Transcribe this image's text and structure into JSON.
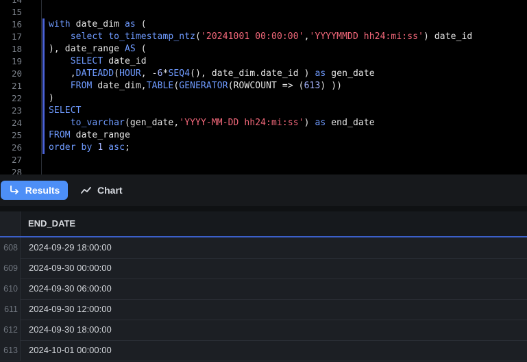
{
  "editor": {
    "lines": [
      {
        "num": "14",
        "tokens": []
      },
      {
        "num": "15",
        "tokens": []
      },
      {
        "num": "16",
        "tokens": [
          {
            "t": "with",
            "c": "kw"
          },
          {
            "t": " date_dim ",
            "c": "plain"
          },
          {
            "t": "as",
            "c": "kw"
          },
          {
            "t": " (",
            "c": "plain"
          }
        ]
      },
      {
        "num": "17",
        "tokens": [
          {
            "t": "    ",
            "c": "plain"
          },
          {
            "t": "select",
            "c": "kw"
          },
          {
            "t": " ",
            "c": "plain"
          },
          {
            "t": "to_timestamp_ntz",
            "c": "kw"
          },
          {
            "t": "(",
            "c": "plain"
          },
          {
            "t": "'20241001 00:00:00'",
            "c": "str"
          },
          {
            "t": ",",
            "c": "plain"
          },
          {
            "t": "'YYYYMMDD hh24:mi:ss'",
            "c": "str"
          },
          {
            "t": ") date_id",
            "c": "plain"
          }
        ]
      },
      {
        "num": "18",
        "tokens": [
          {
            "t": "), date_range ",
            "c": "plain"
          },
          {
            "t": "AS",
            "c": "kw"
          },
          {
            "t": " (",
            "c": "plain"
          }
        ]
      },
      {
        "num": "19",
        "tokens": [
          {
            "t": "    ",
            "c": "plain"
          },
          {
            "t": "SELECT",
            "c": "kw"
          },
          {
            "t": " date_id",
            "c": "plain"
          }
        ]
      },
      {
        "num": "20",
        "tokens": [
          {
            "t": "    ,",
            "c": "plain"
          },
          {
            "t": "DATEADD",
            "c": "kw"
          },
          {
            "t": "(",
            "c": "plain"
          },
          {
            "t": "HOUR",
            "c": "kw"
          },
          {
            "t": ", -",
            "c": "plain"
          },
          {
            "t": "6",
            "c": "num"
          },
          {
            "t": "*",
            "c": "plain"
          },
          {
            "t": "SEQ4",
            "c": "kw"
          },
          {
            "t": "(), date_dim.date_id ) ",
            "c": "plain"
          },
          {
            "t": "as",
            "c": "kw"
          },
          {
            "t": " gen_date",
            "c": "plain"
          }
        ]
      },
      {
        "num": "21",
        "tokens": [
          {
            "t": "    ",
            "c": "plain"
          },
          {
            "t": "FROM",
            "c": "kw"
          },
          {
            "t": " date_dim,",
            "c": "plain"
          },
          {
            "t": "TABLE",
            "c": "kw"
          },
          {
            "t": "(",
            "c": "plain"
          },
          {
            "t": "GENERATOR",
            "c": "kw"
          },
          {
            "t": "(ROWCOUNT => (",
            "c": "plain"
          },
          {
            "t": "613",
            "c": "num"
          },
          {
            "t": ") ))",
            "c": "plain"
          }
        ]
      },
      {
        "num": "22",
        "tokens": [
          {
            "t": ")",
            "c": "plain"
          }
        ]
      },
      {
        "num": "23",
        "tokens": [
          {
            "t": "SELECT",
            "c": "kw"
          }
        ]
      },
      {
        "num": "24",
        "tokens": [
          {
            "t": "    ",
            "c": "plain"
          },
          {
            "t": "to_varchar",
            "c": "kw"
          },
          {
            "t": "(gen_date,",
            "c": "plain"
          },
          {
            "t": "'YYYY-MM-DD hh24:mi:ss'",
            "c": "str"
          },
          {
            "t": ") ",
            "c": "plain"
          },
          {
            "t": "as",
            "c": "kw"
          },
          {
            "t": " end_date",
            "c": "plain"
          }
        ]
      },
      {
        "num": "25",
        "tokens": [
          {
            "t": "FROM",
            "c": "kw"
          },
          {
            "t": " date_range",
            "c": "plain"
          }
        ]
      },
      {
        "num": "26",
        "tokens": [
          {
            "t": "order by",
            "c": "kw"
          },
          {
            "t": " ",
            "c": "plain"
          },
          {
            "t": "1",
            "c": "num"
          },
          {
            "t": " ",
            "c": "plain"
          },
          {
            "t": "asc",
            "c": "kw"
          },
          {
            "t": ";",
            "c": "plain"
          }
        ]
      },
      {
        "num": "27",
        "tokens": []
      },
      {
        "num": "28",
        "tokens": []
      }
    ]
  },
  "toolbar": {
    "results_label": "Results",
    "results_icon": "return-arrow-icon",
    "chart_label": "Chart",
    "chart_icon": "line-chart-icon",
    "accent": "#4d8ff7"
  },
  "grid": {
    "column_header": "END_DATE",
    "rows": [
      {
        "num": "608",
        "value": "2024-09-29 18:00:00"
      },
      {
        "num": "609",
        "value": "2024-09-30 00:00:00"
      },
      {
        "num": "610",
        "value": "2024-09-30 06:00:00"
      },
      {
        "num": "611",
        "value": "2024-09-30 12:00:00"
      },
      {
        "num": "612",
        "value": "2024-09-30 18:00:00"
      },
      {
        "num": "613",
        "value": "2024-10-01 00:00:00"
      }
    ]
  }
}
